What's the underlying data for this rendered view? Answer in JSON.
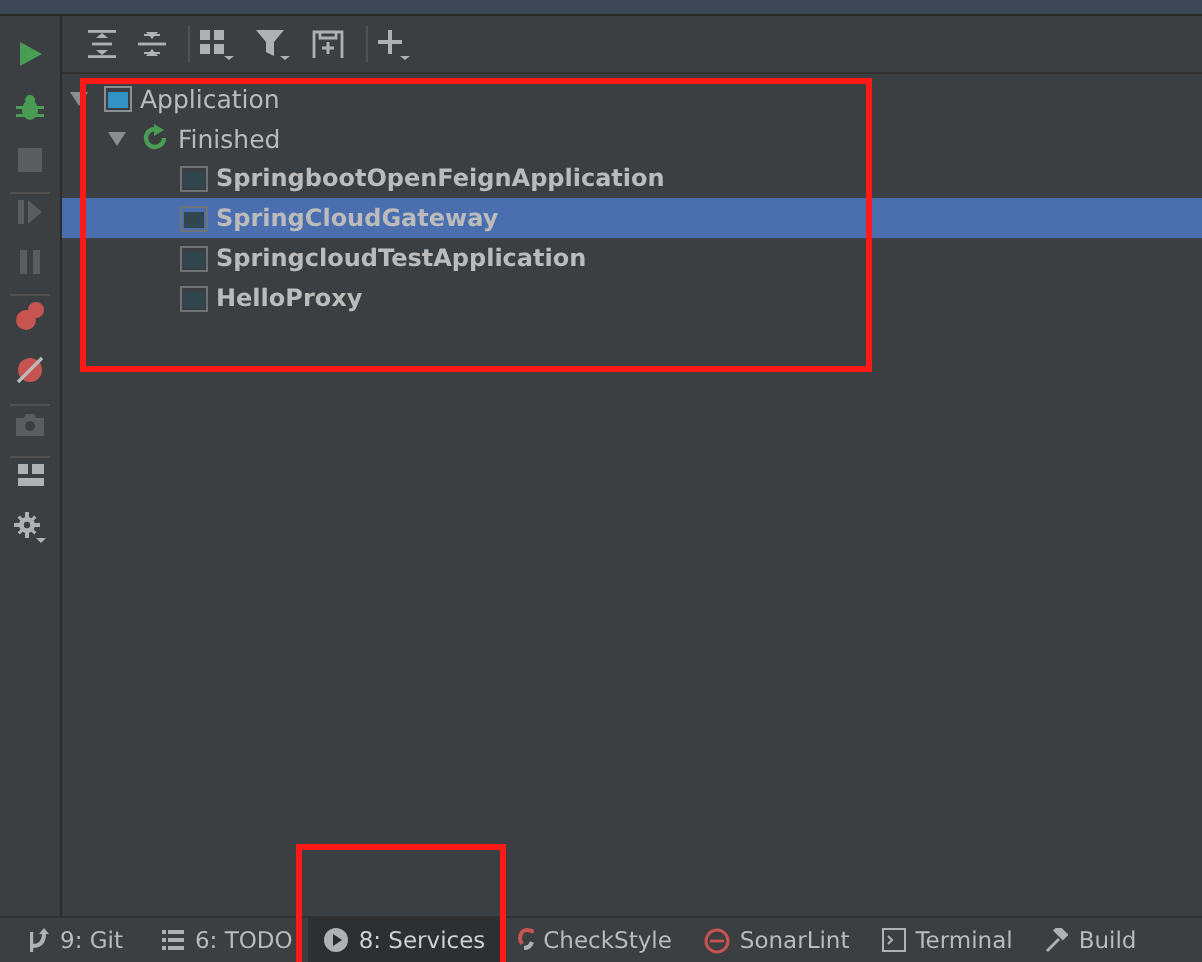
{
  "tree": {
    "highlighted": true,
    "nodes": [
      {
        "label": "Application",
        "kind": "group",
        "expanded": true,
        "selected": false,
        "children": [
          {
            "label": "Finished",
            "kind": "status",
            "expanded": true,
            "selected": false,
            "children": [
              {
                "label": "SpringbootOpenFeignApplication",
                "kind": "app",
                "selected": false
              },
              {
                "label": "SpringCloudGateway",
                "kind": "app",
                "selected": true
              },
              {
                "label": "SpringcloudTestApplication",
                "kind": "app",
                "selected": false
              },
              {
                "label": "HelloProxy",
                "kind": "app",
                "selected": false
              }
            ]
          }
        ]
      }
    ]
  },
  "bottom_tabs": [
    {
      "label": "9: Git",
      "kind": "git",
      "selected": false,
      "highlighted": false
    },
    {
      "label": "6: TODO",
      "kind": "todo",
      "selected": false,
      "highlighted": false
    },
    {
      "label": "8: Services",
      "kind": "services",
      "selected": true,
      "highlighted": true
    },
    {
      "label": "CheckStyle",
      "kind": "checkstyle",
      "selected": false,
      "highlighted": false
    },
    {
      "label": "SonarLint",
      "kind": "sonarlint",
      "selected": false,
      "highlighted": false
    },
    {
      "label": "Terminal",
      "kind": "terminal",
      "selected": false,
      "highlighted": false
    },
    {
      "label": "Build",
      "kind": "build",
      "selected": false,
      "highlighted": false
    }
  ]
}
